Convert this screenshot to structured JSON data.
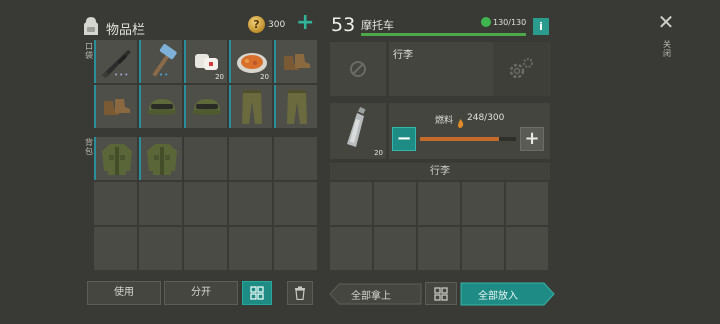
{
  "inventory": {
    "title": "物品栏",
    "coins": "300",
    "add_icon": "plus",
    "pockets_label": "口袋",
    "backpack_label": "背包"
  },
  "pockets": [
    {
      "name": "rifle",
      "qty": "",
      "dots": "•••"
    },
    {
      "name": "hammer",
      "qty": "",
      "dots": "••"
    },
    {
      "name": "bandage",
      "qty": "20",
      "dots": ""
    },
    {
      "name": "food-plate",
      "qty": "20",
      "dots": ""
    },
    {
      "name": "boots",
      "qty": "",
      "dots": ""
    },
    {
      "name": "boots",
      "qty": "",
      "dots": ""
    },
    {
      "name": "helmet",
      "qty": "",
      "dots": ""
    },
    {
      "name": "helmet",
      "qty": "",
      "dots": ""
    },
    {
      "name": "pants",
      "qty": "",
      "dots": ""
    },
    {
      "name": "pants",
      "qty": "",
      "dots": ""
    }
  ],
  "backpack": [
    {
      "name": "jacket"
    },
    {
      "name": "jacket"
    }
  ],
  "actions": {
    "use": "使用",
    "split": "分开",
    "take_all": "全部拿上",
    "put_all": "全部放入"
  },
  "vehicle": {
    "level": "53",
    "name": "摩托车",
    "durability": "130/130",
    "info": "i",
    "trunk_label": "行李",
    "close_label": "关闭",
    "fuel_label": "燃料",
    "fuel_value": "248/300",
    "fuel_fraction": 0.827,
    "fuel_qty": "20",
    "storage_title": "行李"
  },
  "colors": {
    "accent_teal": "#1e8c84",
    "durability_green": "#4ea84a",
    "fuel_orange": "#c46a2a"
  }
}
